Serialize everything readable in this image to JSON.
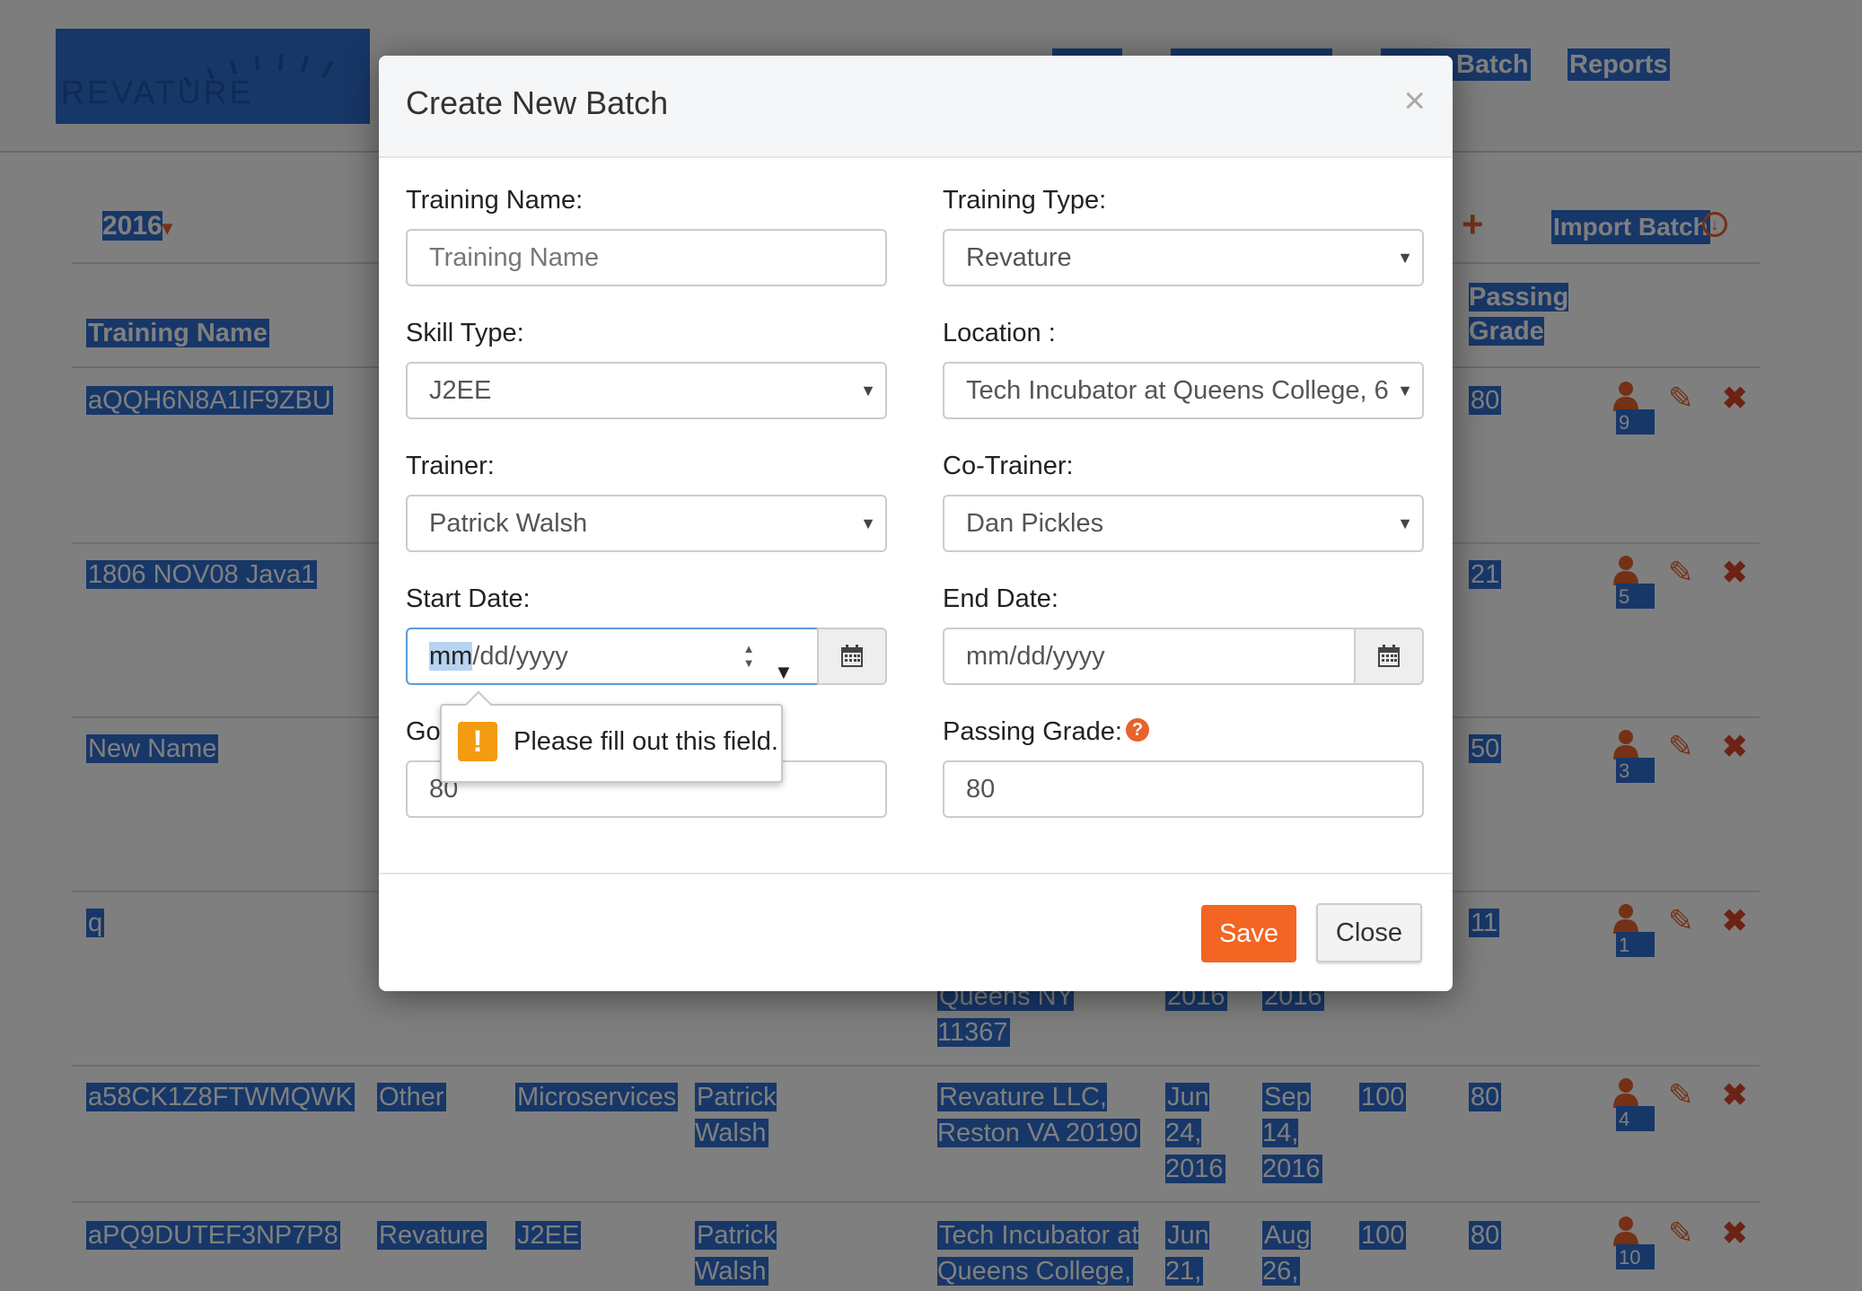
{
  "navbar": {
    "logo_text": "REVATURE",
    "links": [
      "Batch",
      "Reports"
    ]
  },
  "toolbar": {
    "year_filter": "2016",
    "import_label": "Import Batch"
  },
  "table": {
    "headers": {
      "training_name": "Training Name",
      "passing_grade": "Passing Grade"
    },
    "rows": [
      {
        "name": "aQQH6N8A1IF9ZBU",
        "type": "",
        "skill": "",
        "trainer": "",
        "location": "",
        "start": "",
        "end": "",
        "goal": "",
        "grade": "80",
        "count": "9"
      },
      {
        "name": "1806 NOV08 Java1",
        "type": "",
        "skill": "",
        "trainer": "",
        "location": "",
        "start": "",
        "end": "",
        "goal": "",
        "grade": "21",
        "count": "5"
      },
      {
        "name": "New Name",
        "type": "",
        "skill": "",
        "trainer": "",
        "location": "",
        "start": "",
        "end": "",
        "goal": "",
        "grade": "50",
        "count": "3"
      },
      {
        "name": "q",
        "type": "",
        "skill": "",
        "trainer": "",
        "location": "Queens NY 11367",
        "start": "2016",
        "end": "2016",
        "goal": "",
        "grade": "11",
        "count": "1"
      },
      {
        "name": "a58CK1Z8FTWMQWK",
        "type": "Other",
        "skill": "Microservices",
        "trainer": "Patrick Walsh",
        "location": "Revature LLC, Reston VA 20190",
        "start": "Jun 24, 2016",
        "end": "Sep 14, 2016",
        "goal": "100",
        "grade": "80",
        "count": "4"
      },
      {
        "name": "aPQ9DUTEF3NP7P8",
        "type": "Revature",
        "skill": "J2EE",
        "trainer": "Patrick Walsh",
        "location": "Tech Incubator at Queens College,",
        "start": "Jun 21,",
        "end": "Aug 26,",
        "goal": "100",
        "grade": "80",
        "count": "10"
      }
    ]
  },
  "modal": {
    "title": "Create New Batch",
    "close_glyph": "×",
    "training_name_label": "Training Name:",
    "training_name_placeholder": "Training Name",
    "training_type_label": "Training Type:",
    "training_type_value": "Revature",
    "skill_type_label": "Skill Type:",
    "skill_type_value": "J2EE",
    "location_label": "Location :",
    "location_value": "Tech Incubator at Queens College, 6",
    "trainer_label": "Trainer:",
    "trainer_value": "Patrick Walsh",
    "cotrainer_label": "Co-Trainer:",
    "cotrainer_value": "Dan Pickles",
    "start_date_label": "Start Date:",
    "start_date_mm": "mm",
    "start_date_rest": "/dd/yyyy",
    "end_date_label": "End Date:",
    "end_date_placeholder": "mm/dd/yyyy",
    "goal_label": "Go",
    "goal_value": "80",
    "passing_grade_label": "Passing Grade:",
    "passing_grade_value": "80",
    "validation_message": "Please fill out this field.",
    "save_label": "Save",
    "close_label": "Close"
  },
  "colors": {
    "accent": "#f26522",
    "selection": "#2e6fd0",
    "warning": "#f39c12"
  }
}
